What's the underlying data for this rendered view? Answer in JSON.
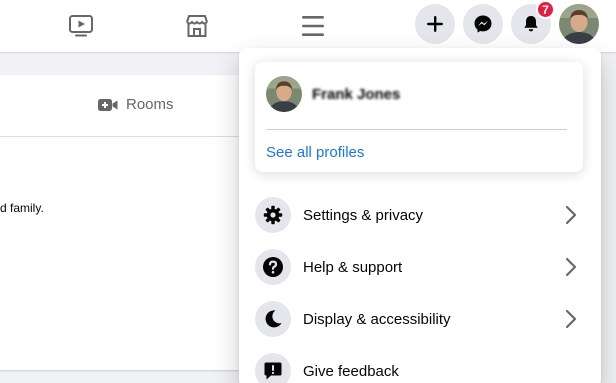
{
  "topbar": {
    "nav_icons": [
      "watch-icon",
      "marketplace-icon",
      "menu-icon"
    ],
    "actions": {
      "create_icon": "plus-icon",
      "messenger_icon": "messenger-icon",
      "notifications": {
        "icon": "bell-icon",
        "badge_count": "7",
        "badge_color": "#e41e3f"
      }
    }
  },
  "background": {
    "rooms_label": "Rooms",
    "post_text_fragment": "d family."
  },
  "menu": {
    "profile": {
      "name": "Frank Jones",
      "see_all_label": "See all profiles"
    },
    "items": [
      {
        "label": "Settings & privacy",
        "icon": "gear-icon"
      },
      {
        "label": "Help & support",
        "icon": "help-icon"
      },
      {
        "label": "Display & accessibility",
        "icon": "moon-icon"
      },
      {
        "label": "Give feedback",
        "icon": "feedback-icon"
      }
    ]
  },
  "colors": {
    "accent": "#1877f2",
    "icon_bg": "#e4e6eb",
    "page_bg": "#f0f2f5"
  }
}
